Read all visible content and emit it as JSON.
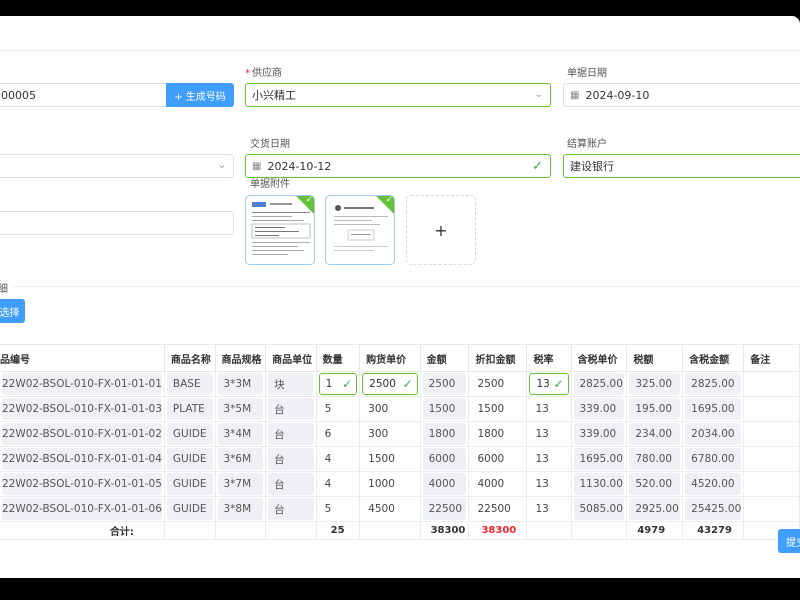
{
  "form": {
    "code_value": "00005",
    "gen_code_button": "+ 生成号码",
    "supplier_label": "供应商",
    "supplier_value": "小兴精工",
    "doc_date_label": "单据日期",
    "doc_date_value": "2024-09-10",
    "delivery_date_label": "交货日期",
    "delivery_date_value": "2024-10-12",
    "settle_account_label": "结算账户",
    "settle_account_value": "建设银行",
    "attachment_label": "单据附件",
    "upload_plus": "+"
  },
  "section": {
    "title_fragment": "细",
    "select_button": "选择"
  },
  "table": {
    "columns": [
      "品编号",
      "商品名称",
      "商品规格",
      "商品单位",
      "数量",
      "购货单价",
      "金额",
      "折扣金额",
      "税率",
      "含税单价",
      "税额",
      "含税金额",
      "备注"
    ],
    "rows": [
      {
        "code": "22W02-BSOL-010-FX-01-01-01",
        "name": "BASE",
        "spec": "3*3M",
        "unit": "块",
        "qty": "1",
        "price": "2500",
        "amount": "2500",
        "discount": "2500",
        "tax_rate": "13",
        "tax_price": "2825.00",
        "tax": "325.00",
        "tax_amount": "2825.00",
        "note": ""
      },
      {
        "code": "22W02-BSOL-010-FX-01-01-03",
        "name": "PLATE",
        "spec": "3*5M",
        "unit": "台",
        "qty": "5",
        "price": "300",
        "amount": "1500",
        "discount": "1500",
        "tax_rate": "13",
        "tax_price": "339.00",
        "tax": "195.00",
        "tax_amount": "1695.00",
        "note": ""
      },
      {
        "code": "22W02-BSOL-010-FX-01-01-02",
        "name": "GUIDE",
        "spec": "3*4M",
        "unit": "台",
        "qty": "6",
        "price": "300",
        "amount": "1800",
        "discount": "1800",
        "tax_rate": "13",
        "tax_price": "339.00",
        "tax": "234.00",
        "tax_amount": "2034.00",
        "note": ""
      },
      {
        "code": "22W02-BSOL-010-FX-01-01-04",
        "name": "GUIDE",
        "spec": "3*6M",
        "unit": "台",
        "qty": "4",
        "price": "1500",
        "amount": "6000",
        "discount": "6000",
        "tax_rate": "13",
        "tax_price": "1695.00",
        "tax": "780.00",
        "tax_amount": "6780.00",
        "note": ""
      },
      {
        "code": "22W02-BSOL-010-FX-01-01-05",
        "name": "GUIDE",
        "spec": "3*7M",
        "unit": "台",
        "qty": "4",
        "price": "1000",
        "amount": "4000",
        "discount": "4000",
        "tax_rate": "13",
        "tax_price": "1130.00",
        "tax": "520.00",
        "tax_amount": "4520.00",
        "note": ""
      },
      {
        "code": "22W02-BSOL-010-FX-01-01-06",
        "name": "GUIDE",
        "spec": "3*8M",
        "unit": "台",
        "qty": "5",
        "price": "4500",
        "amount": "22500",
        "discount": "22500",
        "tax_rate": "13",
        "tax_price": "5085.00",
        "tax": "2925.00",
        "tax_amount": "25425.00",
        "note": ""
      }
    ],
    "summary": {
      "label": "合计:",
      "qty": "25",
      "amount": "38300",
      "discount": "38300",
      "tax": "4979",
      "tax_amount": "43279"
    }
  },
  "footer": {
    "submit_fragment": "提交"
  },
  "colors": {
    "primary": "#409eff",
    "success": "#67c23a",
    "danger": "#f5222d"
  }
}
